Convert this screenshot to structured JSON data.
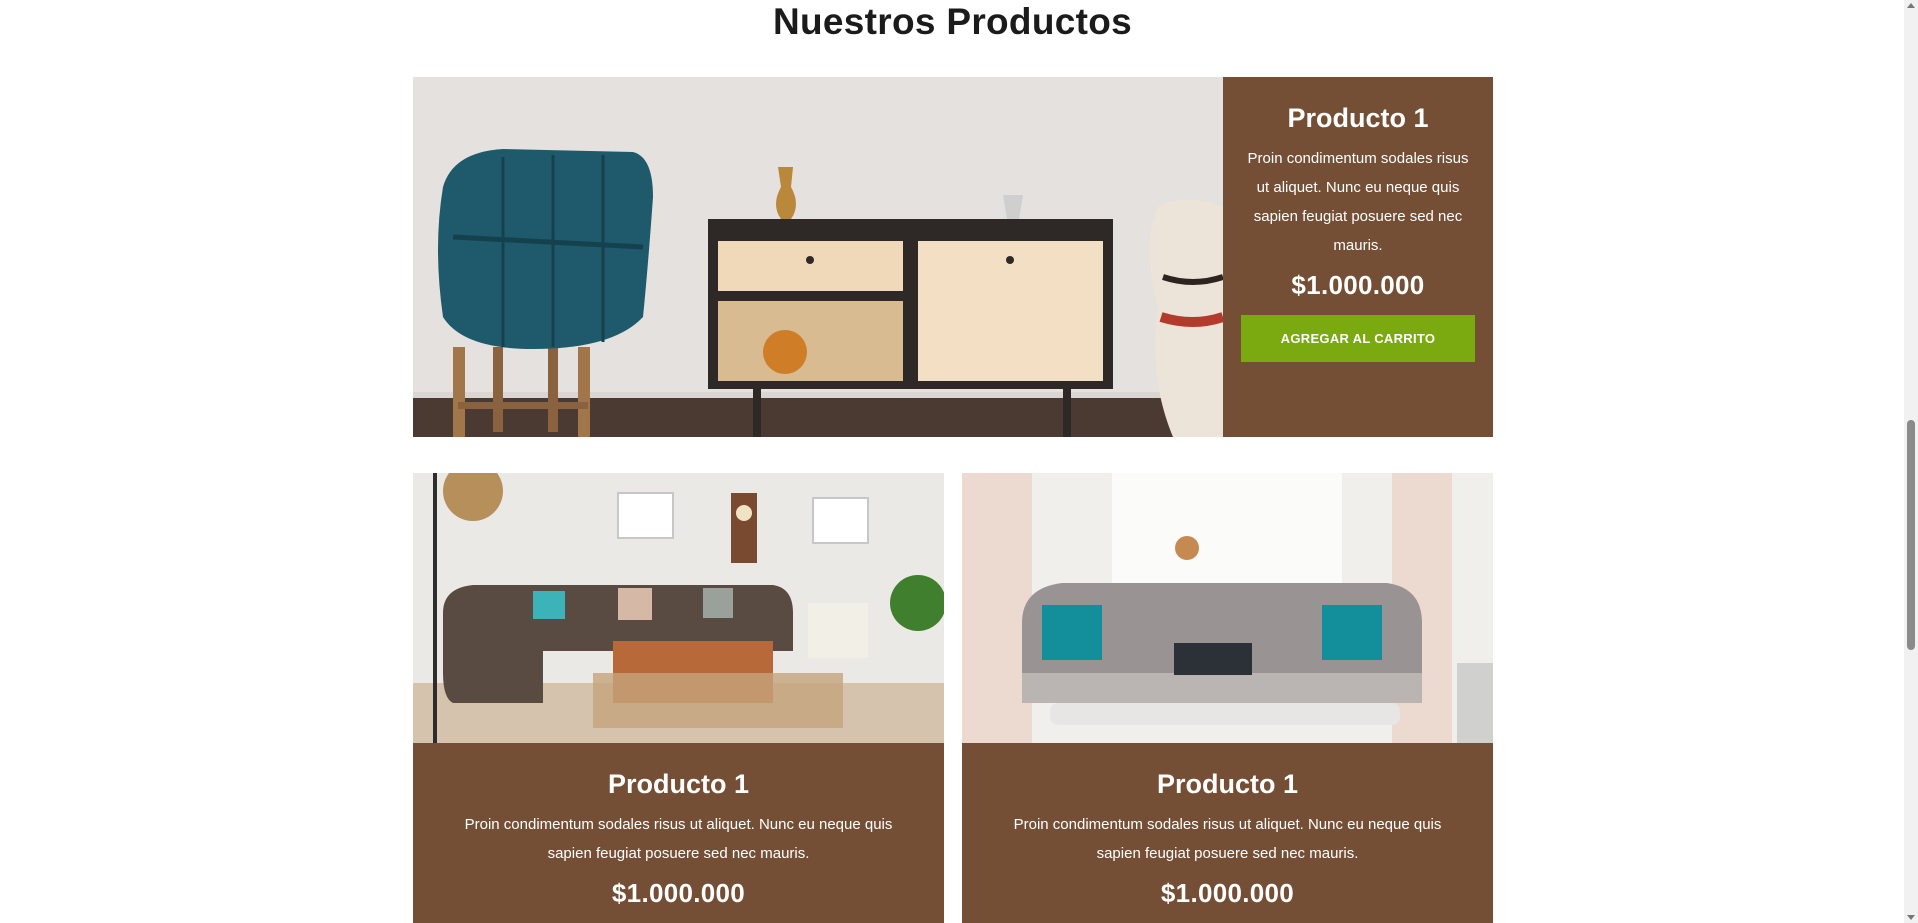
{
  "section": {
    "title": "Nuestros Productos"
  },
  "products": [
    {
      "title": "Producto 1",
      "description": "Proin condimentum sodales risus ut aliquet. Nunc eu neque quis sapien feugiat posuere sed nec mauris.",
      "price": "$1.000.000",
      "button_label": "AGREGAR AL CARRITO"
    },
    {
      "title": "Producto 1",
      "description": "Proin condimentum sodales risus ut aliquet. Nunc eu neque quis sapien feugiat posuere sed nec mauris.",
      "price": "$1.000.000"
    },
    {
      "title": "Producto 1",
      "description": "Proin condimentum sodales risus ut aliquet. Nunc eu neque quis sapien feugiat posuere sed nec mauris.",
      "price": "$1.000.000"
    }
  ],
  "colors": {
    "card_background": "#744f35",
    "button_background": "#7aaa10",
    "text_on_card": "#ffffff",
    "title_text": "#1b1b1b"
  },
  "icons": {
    "scroll_up": "scroll-up-arrow-icon",
    "scroll_down": "scroll-down-arrow-icon"
  }
}
